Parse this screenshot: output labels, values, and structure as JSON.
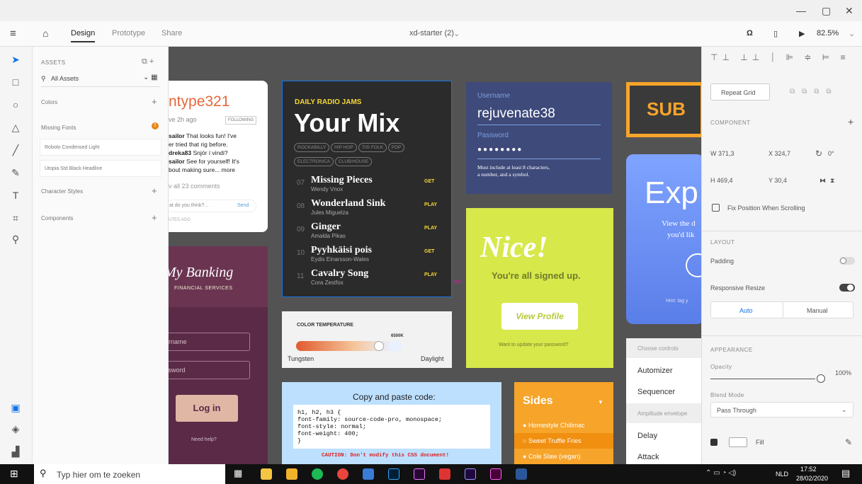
{
  "titlebar": {
    "min": "—",
    "max": "▢",
    "close": "✕"
  },
  "appbar": {
    "tabs": [
      "Design",
      "Prototype",
      "Share"
    ],
    "doc_title": "xd-starter (2)",
    "zoom": "82.5%"
  },
  "assets": {
    "header": "ASSETS",
    "search": "All Assets",
    "colors": "Colors",
    "missing_fonts": "Missing Fonts",
    "fonts": [
      "Roboto Condensed Light",
      "Utopia Std Black Headline"
    ],
    "character_styles": "Character Styles",
    "components": "Components"
  },
  "social": {
    "user": "ntype321",
    "meta": "ve 2h ago",
    "follow": "FOLLOWING",
    "c1_user": "sailor",
    "c1": " That looks fun! I've",
    "c1b": "er tried that rig before.",
    "c2_user": "dreka83",
    "c2": " Snjór í vindi?",
    "c3_user": "sailor",
    "c3": " See for yourself! It's",
    "c3b": "bout making sure... more",
    "all": "v all 23 comments",
    "input": "at do you think?...",
    "send": "Send",
    "ago": "UTES AGO"
  },
  "banking": {
    "title": "My Banking",
    "sub": "FINANCIAL SERVICES",
    "user": "ername",
    "pass": "ssword",
    "login": "Log in",
    "help": "Need help?"
  },
  "mix": {
    "kicker": "DAILY RADIO JAMS",
    "title": "Your Mix",
    "tags": [
      "ROCKABILLY",
      "HIP HOP",
      "70S FOLK",
      "POP",
      "ELECTRONICA",
      "CLUB/HOUSE"
    ],
    "tracks": [
      {
        "n": "07",
        "t": "Missing Pieces",
        "a": "Wendy Vnox",
        "b": "GET"
      },
      {
        "n": "08",
        "t": "Wonderland Sink",
        "a": "Jules Miguelza",
        "b": "PLAY"
      },
      {
        "n": "09",
        "t": "Ginger",
        "a": "Amalda Pikas",
        "b": "PLAY"
      },
      {
        "n": "10",
        "t": "Pyyhkäisi pois",
        "a": "Eydis Einarsson-Wales",
        "b": "GET"
      },
      {
        "n": "11",
        "t": "Cavalry Song",
        "a": "Cora Zestfox",
        "b": "PLAY"
      }
    ],
    "measure": "30.1"
  },
  "login": {
    "ulabel": "Username",
    "uval": "rejuvenate38",
    "plabel": "Password",
    "pval": "●●●●●●●●",
    "hint1": "Must include at least 8 characters,",
    "hint2": "a number, and a symbol."
  },
  "nice": {
    "title": "Nice!",
    "sub": "You're all signed up.",
    "btn": "View Profile",
    "q": "Want to update your password?"
  },
  "temp": {
    "label": "COLOR TEMPERATURE",
    "value": "6500K",
    "left": "Tungsten",
    "right": "Daylight",
    "level": 0.78
  },
  "code": {
    "title": "Copy and paste code:",
    "lines": [
      "h1, h2, h3 {",
      "font-family: source-code-pro, monospace;",
      "font-style: normal;",
      "font-weight: 400;",
      "}"
    ],
    "caution": "CAUTION: Don't modify this CSS document!"
  },
  "sides": {
    "title": "Sides",
    "items": [
      "Homestyle Chilimac",
      "Sweet Truffle Fries",
      "Cole Slaw (vegan)"
    ]
  },
  "sub": {
    "text": "SUB"
  },
  "exp": {
    "text": "Exp",
    "l1": "View the d",
    "l2": "you'd lik",
    "hint": "Hint: tag y"
  },
  "controls": {
    "h1": "Choose controls",
    "items": [
      "Automizer",
      "Sequencer"
    ],
    "h2": "Amplitude envelope",
    "items2": [
      "Delay",
      "Attack"
    ]
  },
  "rpanel": {
    "repeat": "Repeat Grid",
    "component": "COMPONENT",
    "w": "W  371,3",
    "x": "X  324,7",
    "rot": "0°",
    "h": "H  469,4",
    "y": "Y  30,4",
    "fix": "Fix Position When Scrolling",
    "layout": "LAYOUT",
    "padding": "Padding",
    "resp": "Responsive Resize",
    "auto": "Auto",
    "manual": "Manual",
    "appearance": "APPEARANCE",
    "opacity": "Opacity",
    "opacity_val": "100%",
    "blend": "Blend Mode",
    "blend_val": "Pass Through",
    "fill": "Fill"
  },
  "taskbar": {
    "search": "Typ hier om te zoeken",
    "lang": "NLD",
    "time": "17:52",
    "date": "28/02/2020"
  }
}
